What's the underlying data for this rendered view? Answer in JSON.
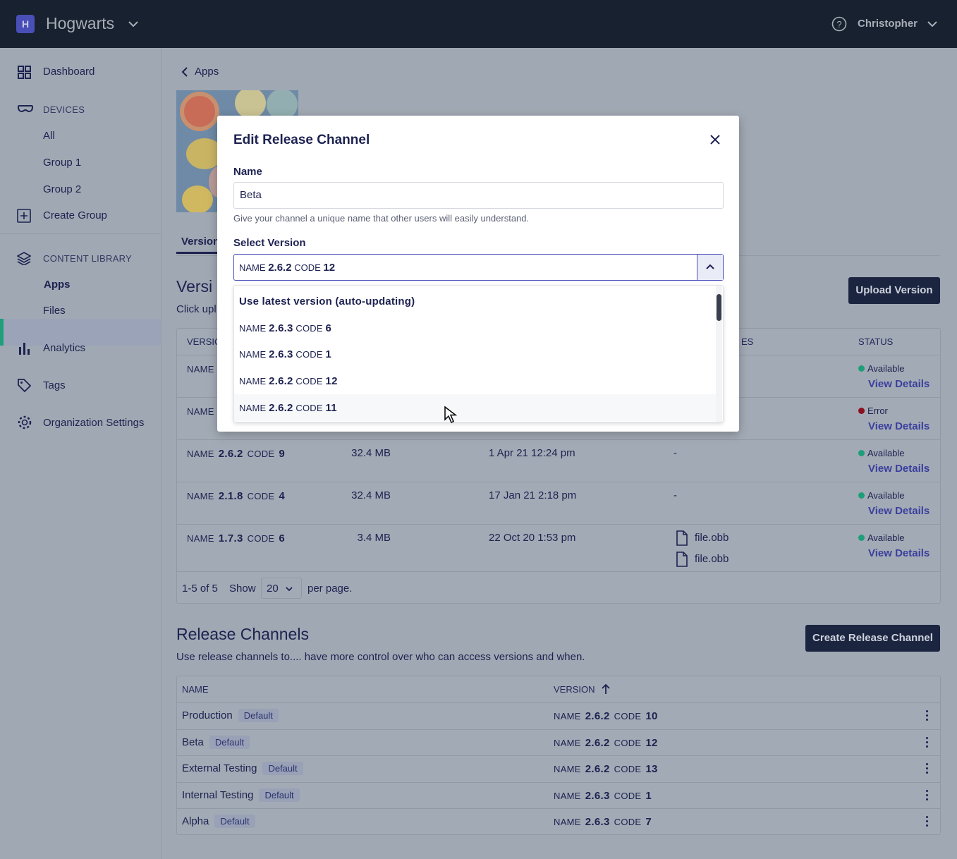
{
  "header": {
    "logo_letter": "H",
    "org": "Hogwarts",
    "user": "Christopher"
  },
  "sidebar": {
    "dashboard": "Dashboard",
    "devices": "DEVICES",
    "all": "All",
    "group1": "Group 1",
    "group2": "Group 2",
    "create_group": "Create Group",
    "content_library": "CONTENT LIBRARY",
    "apps": "Apps",
    "files": "Files",
    "analytics": "Analytics",
    "tags": "Tags",
    "org_settings": "Organization Settings",
    "active_color": "#1e9e7a"
  },
  "main": {
    "breadcrumb": "Apps",
    "tab_versions": "Version",
    "versions_title": "Versi",
    "versions_sub": "Click upl",
    "upload_btn": "Upload Version",
    "versions_table": {
      "headers": {
        "version": "VERSIC",
        "files": "ES",
        "status": "STATUS"
      },
      "rows": [
        {
          "name_label": "NAME",
          "name": "",
          "code_label": "",
          "code": "",
          "size": "",
          "date": "",
          "files": [],
          "status": "Available",
          "link": "View Details"
        },
        {
          "name_label": "NAME",
          "name": "",
          "code_label": "",
          "code": "",
          "size": "",
          "date": "",
          "files": [],
          "status": "Error",
          "link": "View Details"
        },
        {
          "name_label": "NAME",
          "name": "2.6.2",
          "code_label": "CODE",
          "code": "9",
          "size": "32.4 MB",
          "date": "1 Apr 21 12:24 pm",
          "files": [
            "-"
          ],
          "status": "Available",
          "link": "View Details"
        },
        {
          "name_label": "NAME",
          "name": "2.1.8",
          "code_label": "CODE",
          "code": "4",
          "size": "32.4 MB",
          "date": "17 Jan 21 2:18 pm",
          "files": [
            "-"
          ],
          "status": "Available",
          "link": "View Details"
        },
        {
          "name_label": "NAME",
          "name": "1.7.3",
          "code_label": "CODE",
          "code": "6",
          "size": "3.4 MB",
          "date": "22 Oct 20 1:53 pm",
          "files": [
            "file.obb",
            "file.obb"
          ],
          "status": "Available",
          "link": "View Details"
        }
      ],
      "footer": {
        "range": "1-5 of 5",
        "show": "Show",
        "per_page_value": "20",
        "per_page": "per page."
      }
    },
    "release_title": "Release Channels",
    "release_sub": "Use release channels to.... have more control over who can access versions and when.",
    "create_btn": "Create Release Channel",
    "channels_table": {
      "headers": {
        "name": "NAME",
        "version": "VERSION"
      },
      "rows": [
        {
          "name": "Production",
          "badge": "Default",
          "ver": "2.6.2",
          "code": "10"
        },
        {
          "name": "Beta",
          "badge": "Default",
          "ver": "2.6.2",
          "code": "12"
        },
        {
          "name": "External Testing",
          "badge": "Default",
          "ver": "2.6.2",
          "code": "13"
        },
        {
          "name": "Internal Testing",
          "badge": "Default",
          "ver": "2.6.3",
          "code": "1"
        },
        {
          "name": "Alpha",
          "badge": "Default",
          "ver": "2.6.3",
          "code": "7"
        }
      ]
    }
  },
  "status_colors": {
    "Available": "#1e9e7a",
    "Error": "#8b1020"
  },
  "modal": {
    "title": "Edit Release Channel",
    "name_label": "Name",
    "name_value": "Beta",
    "help": "Give your channel a unique name that other users will easily understand.",
    "select_label": "Select Version",
    "selected": {
      "name_label": "NAME",
      "name": "2.6.2",
      "code_label": "CODE",
      "code": "12"
    },
    "options": [
      {
        "text": "Use latest version (auto-updating)"
      },
      {
        "name": "2.6.3",
        "code": "6"
      },
      {
        "name": "2.6.3",
        "code": "1"
      },
      {
        "name": "2.6.2",
        "code": "12"
      },
      {
        "name": "2.6.2",
        "code": "11",
        "hovered": true
      }
    ],
    "opt_name_label": "NAME",
    "opt_code_label": "CODE"
  }
}
